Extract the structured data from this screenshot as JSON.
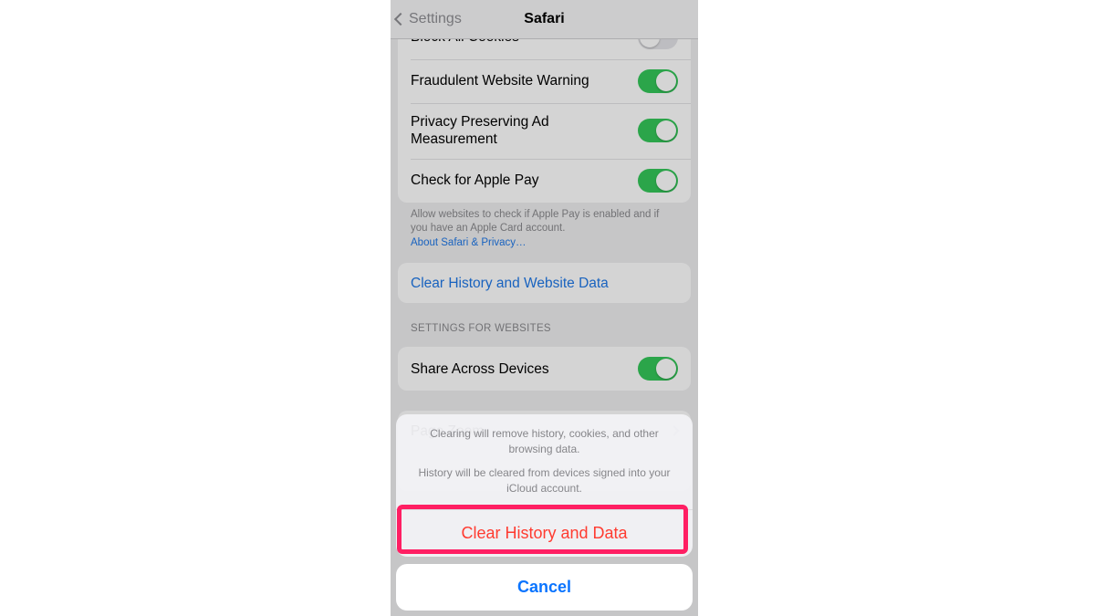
{
  "nav": {
    "back": "Settings",
    "title": "Safari"
  },
  "privacy": {
    "items": [
      {
        "label": "Block All Cookies",
        "on": false
      },
      {
        "label": "Fraudulent Website Warning",
        "on": true
      },
      {
        "label": "Privacy Preserving Ad Measurement",
        "on": true
      },
      {
        "label": "Check for Apple Pay",
        "on": true
      }
    ],
    "footer": "Allow websites to check if Apple Pay is enabled and if you have an Apple Card account.",
    "link": "About Safari & Privacy…"
  },
  "clear": {
    "label": "Clear History and Website Data"
  },
  "websites": {
    "header": "Settings for Websites",
    "items": [
      {
        "label": "Share Across Devices",
        "on": true
      },
      {
        "label": "Page Zoom"
      }
    ]
  },
  "sheet": {
    "msg1": "Clearing will remove history, cookies, and other browsing data.",
    "msg2": "History will be cleared from devices signed into your iCloud account.",
    "action": "Clear History and Data",
    "cancel": "Cancel"
  },
  "colors": {
    "accent_green": "#34c759",
    "link_blue": "#1f77e6",
    "destructive_red": "#ff3b30",
    "highlight_pink": "#ff1f63"
  }
}
